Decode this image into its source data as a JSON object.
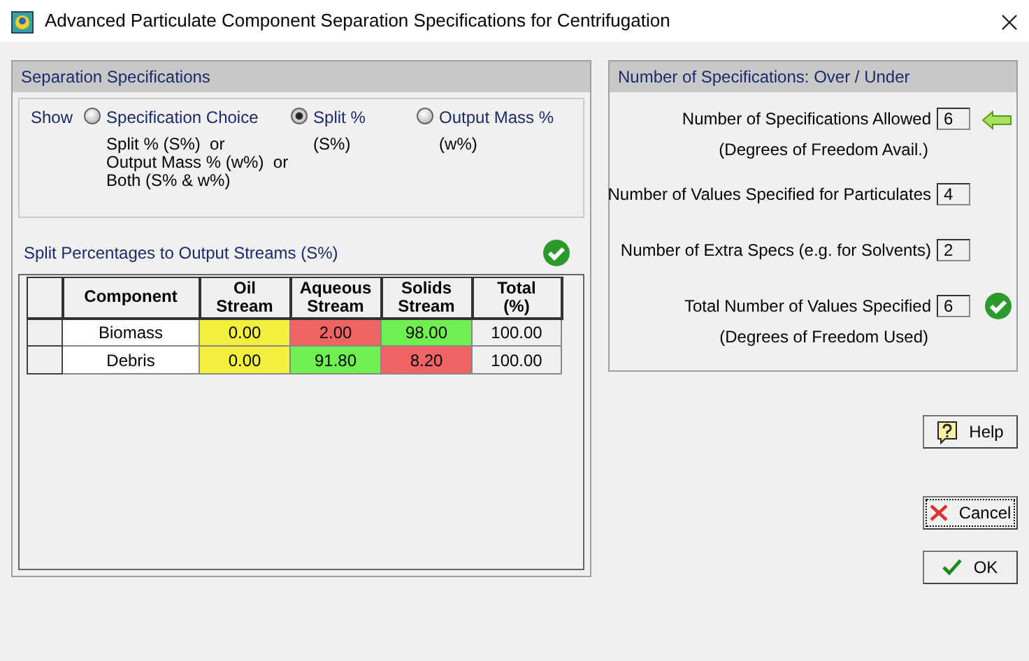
{
  "window": {
    "title": "Advanced Particulate Component Separation Specifications for Centrifugation"
  },
  "separation": {
    "title": "Separation Specifications",
    "show_label": "Show",
    "options": [
      {
        "label": "Specification Choice",
        "detail": [
          "Split % (S%)  or",
          "Output Mass % (w%)  or",
          "Both (S% & w%)"
        ],
        "selected": false
      },
      {
        "label": "Split %",
        "detail": [
          "(S%)"
        ],
        "selected": true
      },
      {
        "label": "Output Mass %",
        "detail": [
          "(w%)"
        ],
        "selected": false
      }
    ],
    "grid_title": "Split Percentages to Output Streams (S%)",
    "table": {
      "columns": [
        "Component",
        "Oil\nStream",
        "Aqueous\nStream",
        "Solids\nStream",
        "Total\n(%)"
      ],
      "rows": [
        {
          "cells": [
            {
              "text": "Biomass",
              "color": "#ffffff"
            },
            {
              "text": "0.00",
              "color": "#f2f03c"
            },
            {
              "text": "2.00",
              "color": "#f06464"
            },
            {
              "text": "98.00",
              "color": "#6ef050"
            },
            {
              "text": "100.00",
              "color": "#f0f0f0"
            }
          ]
        },
        {
          "cells": [
            {
              "text": "Debris",
              "color": "#ffffff"
            },
            {
              "text": "0.00",
              "color": "#f2f03c"
            },
            {
              "text": "91.80",
              "color": "#6ef050"
            },
            {
              "text": "8.20",
              "color": "#f06464"
            },
            {
              "text": "100.00",
              "color": "#f0f0f0"
            }
          ]
        }
      ]
    }
  },
  "counts": {
    "title": "Number of Specifications: Over / Under",
    "rows": [
      {
        "label": "Number of Specifications Allowed",
        "note": "(Degrees of Freedom Avail.)",
        "value": "6",
        "kind": "arrow"
      },
      {
        "label": "Number of Values Specified for Particulates",
        "value": "4",
        "kind": "plain"
      },
      {
        "label": "Number of Extra Specs (e.g. for Solvents)",
        "value": "2",
        "kind": "plain"
      },
      {
        "label": "Total Number of Values Specified",
        "note": "(Degrees of Freedom Used)",
        "value": "6",
        "kind": "check"
      }
    ]
  },
  "buttons": [
    {
      "label": "Help",
      "kind": "help"
    },
    {
      "label": "Cancel",
      "kind": "cancel"
    },
    {
      "label": "OK",
      "kind": "ok"
    }
  ]
}
